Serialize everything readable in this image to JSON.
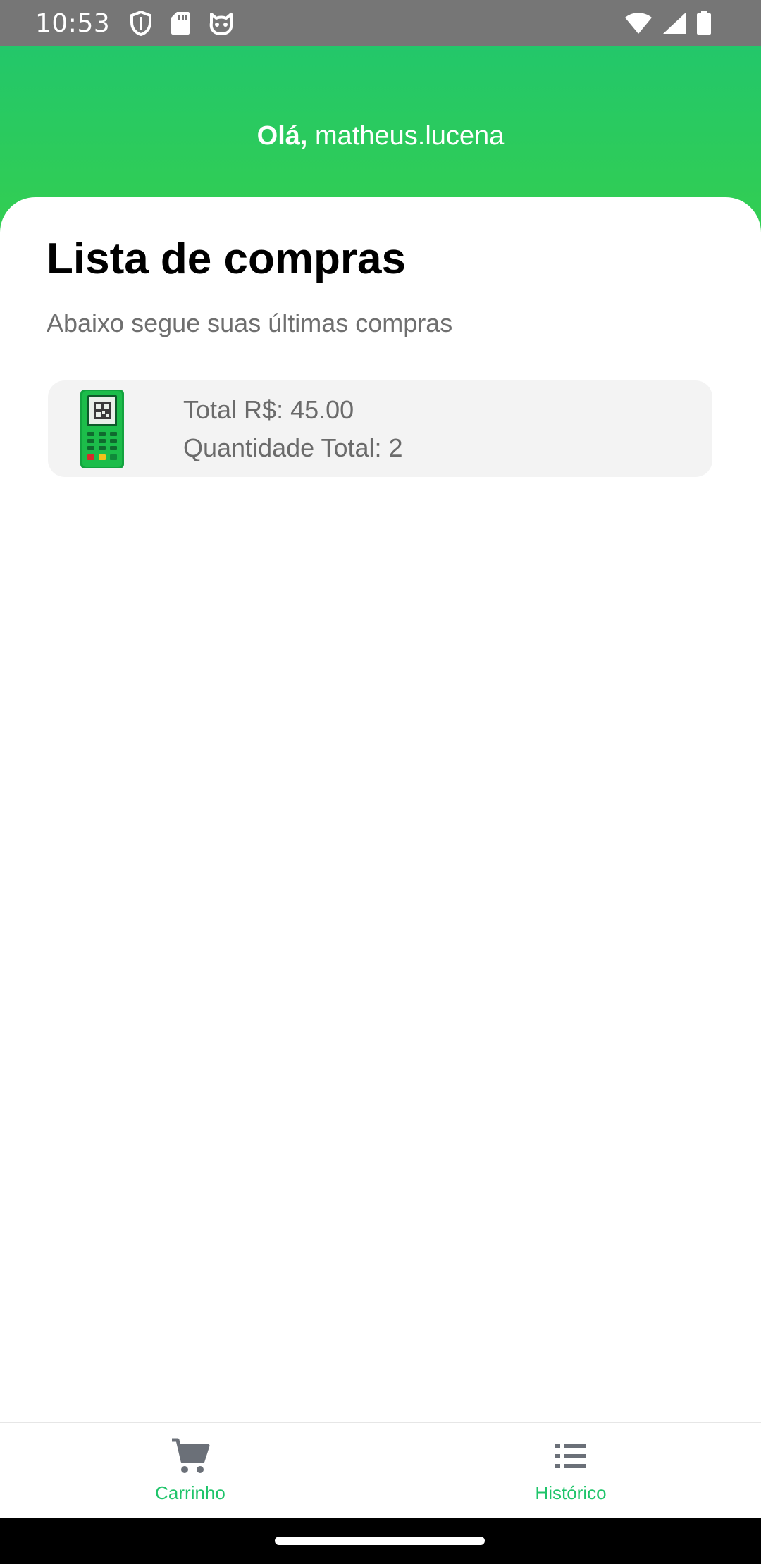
{
  "status_bar": {
    "time": "10:53",
    "left_icons": [
      "shield-icon",
      "sd-card-icon",
      "cat-face-icon"
    ],
    "right_icons": [
      "wifi-icon",
      "signal-icon",
      "battery-icon"
    ],
    "background": "#767676"
  },
  "header": {
    "greeting_bold": "Olá,",
    "username": "matheus.lucena",
    "gradient_start": "#23c76a",
    "gradient_end": "#35cf4e"
  },
  "main": {
    "title": "Lista de compras",
    "subtitle": "Abaixo segue suas últimas compras",
    "purchases": [
      {
        "image_icon": "card-machine-icon",
        "total_text": "Total R$: 45.00",
        "quantity_text": "Quantidade Total: 2"
      }
    ]
  },
  "bottom_nav": {
    "items": [
      {
        "icon": "cart-icon",
        "label": "Carrinho"
      },
      {
        "icon": "list-icon",
        "label": "Histórico"
      }
    ],
    "accent_color": "#1fc46a",
    "icon_color": "#6b7078"
  }
}
